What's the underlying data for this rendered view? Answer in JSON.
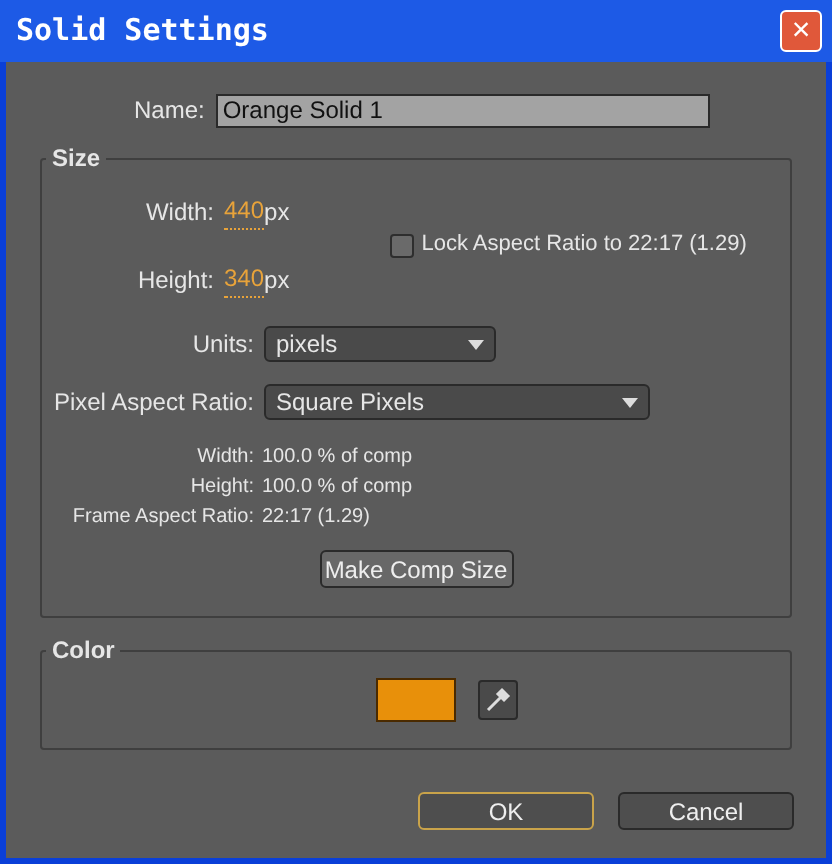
{
  "window": {
    "title": "Solid Settings",
    "close": "×"
  },
  "name": {
    "label": "Name:",
    "value": "Orange Solid 1"
  },
  "size": {
    "title": "Size",
    "width": {
      "label": "Width:",
      "value": "440",
      "unit": "px"
    },
    "height": {
      "label": "Height:",
      "value": "340",
      "unit": "px"
    },
    "lock": {
      "label": "Lock Aspect Ratio to 22:17 (1.29)",
      "checked": false
    },
    "units": {
      "label": "Units:",
      "value": "pixels"
    },
    "pixel_aspect": {
      "label": "Pixel Aspect Ratio:",
      "value": "Square Pixels"
    },
    "info": [
      {
        "label": "Width:",
        "value": "100.0 % of comp"
      },
      {
        "label": "Height:",
        "value": "100.0 % of comp"
      },
      {
        "label": "Frame Aspect Ratio:",
        "value": "22:17 (1.29)"
      }
    ],
    "make_comp_size": "Make Comp Size"
  },
  "color": {
    "title": "Color",
    "color": "#e8900a"
  },
  "buttons": [
    {
      "label": "OK",
      "default": true
    },
    {
      "label": "Cancel",
      "default": false
    }
  ]
}
